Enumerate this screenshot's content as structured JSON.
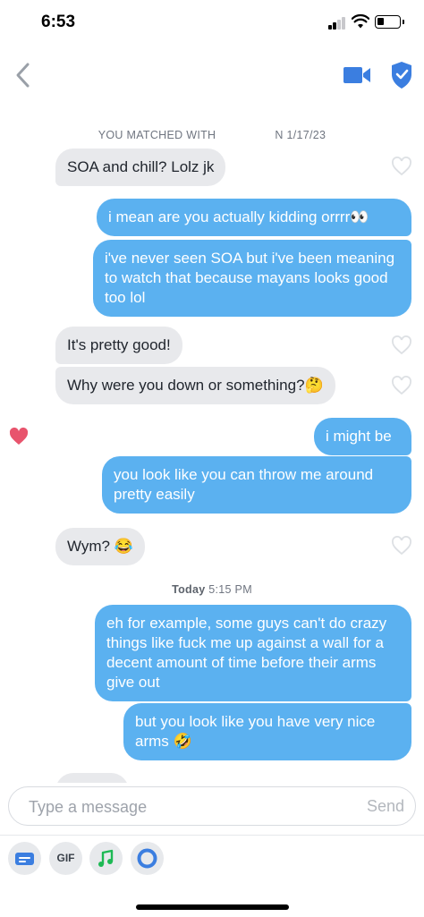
{
  "status_bar": {
    "time": "6:53"
  },
  "header": {
    "icons": [
      "chevron-left-icon",
      "video-camera-icon",
      "shield-icon"
    ]
  },
  "chat": {
    "match_line_prefix": "YOU MATCHED WITH",
    "match_line_suffix": "N 1/17/23",
    "messages": [
      {
        "from": "them",
        "text": "SOA and chill? Lolz jk",
        "liked": false
      },
      {
        "from": "me",
        "text": "i mean are you actually kidding orrrr",
        "emoji": "👀"
      },
      {
        "from": "me",
        "text": "i've never seen SOA but i've been meaning to watch that because mayans looks good too lol"
      },
      {
        "from": "them",
        "text": "It's pretty good!",
        "liked": false
      },
      {
        "from": "them",
        "text": "Why were you down or something?",
        "emoji": "🤔",
        "liked": false
      },
      {
        "from": "me",
        "text": "i might be",
        "liked_by_them": true
      },
      {
        "from": "me",
        "text": "you look like you can throw me around pretty easily"
      },
      {
        "from": "them",
        "text": "Wym?",
        "emoji": "😂",
        "liked": false
      },
      {
        "from": "me",
        "text": "eh for example, some guys can't do crazy things like fuck me up against a wall for a decent amount of time before their arms give out"
      },
      {
        "from": "me",
        "text": "but you look like you have very nice arms",
        "emoji": "🤣"
      }
    ],
    "day_separator": {
      "day": "Today",
      "time": "5:15 PM"
    }
  },
  "composer": {
    "placeholder": "Type a message",
    "send_label": "Send",
    "tools": [
      {
        "name": "card-icon"
      },
      {
        "name": "gif-button",
        "label": "GIF"
      },
      {
        "name": "music-note-icon"
      },
      {
        "name": "circle-icon"
      }
    ]
  },
  "colors": {
    "outgoing": "#5bb1f0",
    "incoming": "#e8e9ec",
    "brand_blue": "#3b7ee0",
    "heart": "#e8546d"
  }
}
